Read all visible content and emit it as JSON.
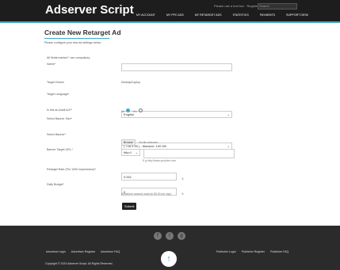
{
  "header": {
    "brand": "Adserver Script",
    "top_links": [
      "Please use a text box",
      "Register",
      "Login"
    ],
    "search_placeholder": "Search",
    "nav": [
      "MY ACCOUNT",
      "MY PPC ADS",
      "MY RETARGET ADS",
      "STATISTICS",
      "PAYMENTS",
      "SUPPORT DESK"
    ]
  },
  "page": {
    "title": "Create New Retarget Ad",
    "subtitle": "Please configure your new ad settings below.",
    "required_note": "All fields marked * are compulsory."
  },
  "form": {
    "name_label": "Name*",
    "name_value": "",
    "target_device_label": "Target Device",
    "target_device_value": "Desktop/Laptop",
    "target_language_label": "Target Language*",
    "target_language_value": "English",
    "adult_label": "Is this an Adult Ad?*",
    "adult_no": "No",
    "adult_yes": "Yes",
    "banner_size_label": "Select Banner Size*",
    "banner_size_value": "( 728 x 90 ) - Maxsize: 100 KB",
    "select_banner_label": "Select Banner*",
    "browse_label": "Browse",
    "no_file_label": "No file selected.",
    "target_url_label": "Banner Target URL *",
    "url_scheme": "http://",
    "url_value": "",
    "url_hint": "E.g http://www.youtube.com",
    "rate_label": "Retarget Rate (Per 1000 impressions)*",
    "rate_value": "0.001",
    "rate_unit": "$",
    "budget_label": "Daily Budget*",
    "budget_value": "0",
    "budget_unit": "$",
    "budget_hint": "(Minimum amount must be $0.00 per day)",
    "submit_label": "Submit"
  },
  "footer": {
    "social_icons": [
      "facebook-icon",
      "twitter-icon",
      "google-plus-icon"
    ],
    "left_links": [
      "Advertiser login",
      "Advertiser Register",
      "Advertiser FAQ"
    ],
    "right_links": [
      "Publisher Login",
      "Publisher Register",
      "Publisher FAQ"
    ],
    "copyright": "Copyright © 2024 Adserver Script. All Rights Reserved."
  }
}
